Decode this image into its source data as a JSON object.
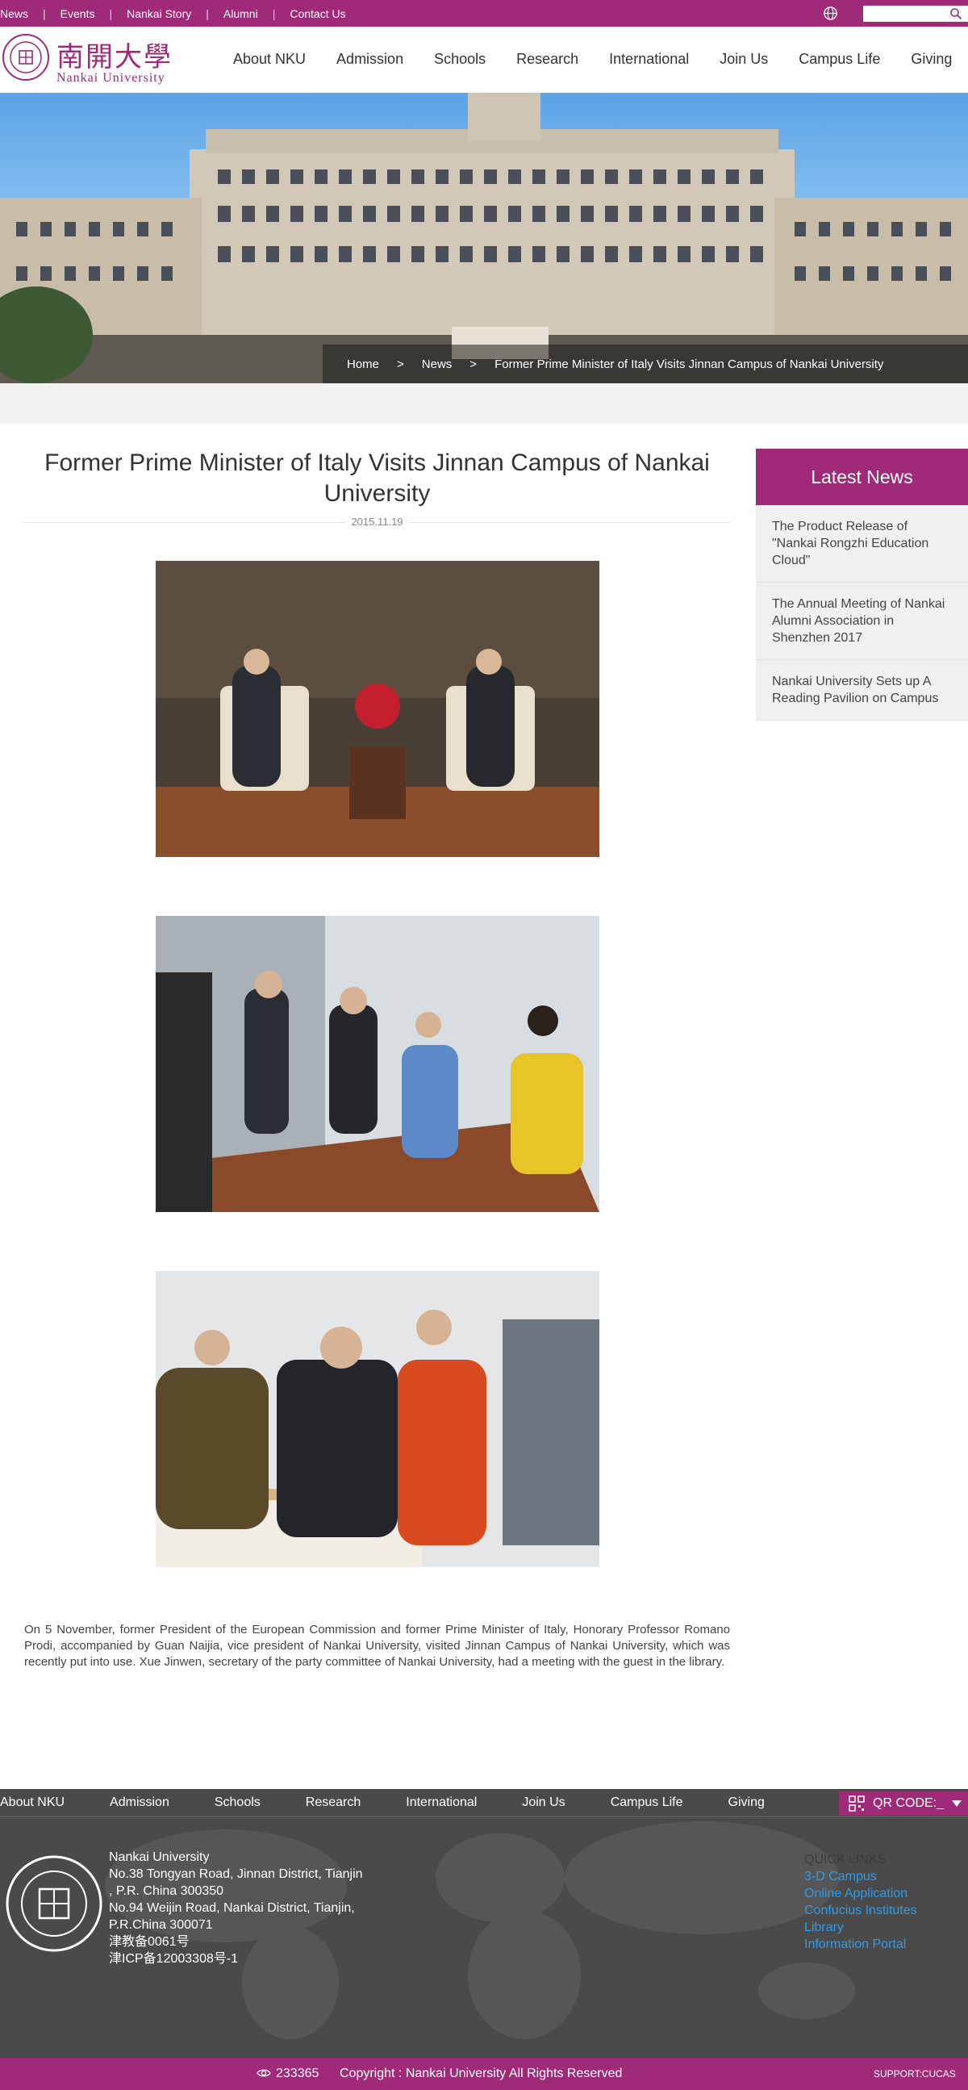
{
  "topbar": {
    "links": [
      "News",
      "Events",
      "Nankai Story",
      "Alumni",
      "Contact Us"
    ],
    "search_placeholder": ""
  },
  "brand": {
    "name_cn": "南開大學",
    "name_en": "Nankai University",
    "color": "#9e2a78"
  },
  "nav": [
    "About NKU",
    "Admission",
    "Schools",
    "Research",
    "International",
    "Join Us",
    "Campus Life",
    "Giving"
  ],
  "breadcrumb": [
    "Home",
    "News",
    "Former Prime Minister of Italy Visits Jinnan Campus of Nankai University"
  ],
  "article": {
    "title": "Former Prime Minister of Italy Visits Jinnan Campus of Nankai University",
    "date": "2015.11.19",
    "body": "On 5 November, former President of the European Commission and former Prime Minister of Italy, Honorary Professor Romano Prodi, accompanied by Guan Naijia, vice president of Nankai University, visited Jinnan Campus of Nankai University, which was recently put into use. Xue Jinwen, secretary of the party committee of Nankai University, had a meeting with the guest in the library.",
    "photos": [
      "meeting-photo",
      "discussion-photo",
      "library-signing-photo"
    ]
  },
  "sidebar": {
    "heading": "Latest News",
    "items": [
      "The Product Release of \"Nankai Rongzhi Education Cloud\"",
      "The Annual Meeting of Nankai Alumni Association in Shenzhen 2017",
      "Nankai University Sets up A Reading Pavilion on Campus"
    ]
  },
  "footer": {
    "nav": [
      "About NKU",
      "Admission",
      "Schools",
      "Research",
      "International",
      "Join Us",
      "Campus Life",
      "Giving"
    ],
    "qr_label": "QR CODE:_",
    "address_lines": [
      "Nankai University",
      "No.38 Tongyan Road, Jinnan District, Tianjin",
      ", P.R. China 300350",
      "No.94 Weijin Road,  Nankai District, Tianjin,",
      "P.R.China  300071",
      "津教备0061号",
      "津ICP备12003308号-1"
    ],
    "quick_links_title": "QUICK LINKS",
    "quick_links": [
      "3-D Campus",
      "Online Application",
      "Confucius Institutes",
      "Library",
      "Information Portal"
    ],
    "visits": "233365",
    "copyright": "Copyright : Nankai University All Rights Reserved",
    "support": "SUPPORT:CUCAS"
  }
}
